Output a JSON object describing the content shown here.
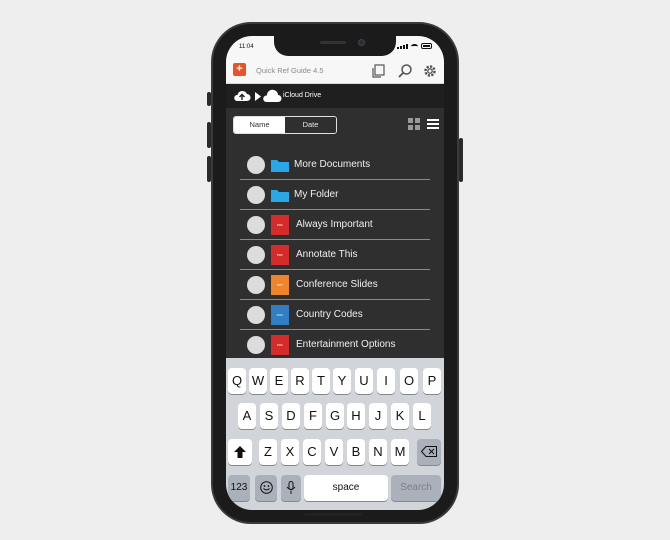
{
  "status_bar": {
    "time": "11:04"
  },
  "app_bar": {
    "title": "Quick Ref Guide 4.5",
    "logo_glyph": "+"
  },
  "breadcrumb": {
    "current": "iCloud Drive"
  },
  "sort": {
    "options": [
      "Name",
      "Date"
    ],
    "selected": "Name"
  },
  "files": [
    {
      "name": "More Documents",
      "kind": "folder",
      "badge": ""
    },
    {
      "name": "My Folder",
      "kind": "folder",
      "badge": ""
    },
    {
      "name": "Always Important",
      "kind": "pdf",
      "badge": "PDF"
    },
    {
      "name": "Annotate This",
      "kind": "pdf",
      "badge": "PDF"
    },
    {
      "name": "Conference Slides",
      "kind": "ppt",
      "badge": "PPT"
    },
    {
      "name": "Country Codes",
      "kind": "doc",
      "badge": "DOC"
    },
    {
      "name": "Entertainment Options",
      "kind": "pdf",
      "badge": "PDF"
    }
  ],
  "keyboard": {
    "row1": [
      "Q",
      "W",
      "E",
      "R",
      "T",
      "Y",
      "U",
      "I",
      "O",
      "P"
    ],
    "row2": [
      "A",
      "S",
      "D",
      "F",
      "G",
      "H",
      "J",
      "K",
      "L"
    ],
    "row3": [
      "Z",
      "X",
      "C",
      "V",
      "B",
      "N",
      "M"
    ],
    "numbers_key": "123",
    "space_key": "space",
    "return_key": "Search"
  },
  "colors": {
    "accent": "#e8532a",
    "folder": "#2aa7e6",
    "pdf": "#d62b2b",
    "ppt": "#f0842a",
    "doc": "#2f7fc2"
  }
}
